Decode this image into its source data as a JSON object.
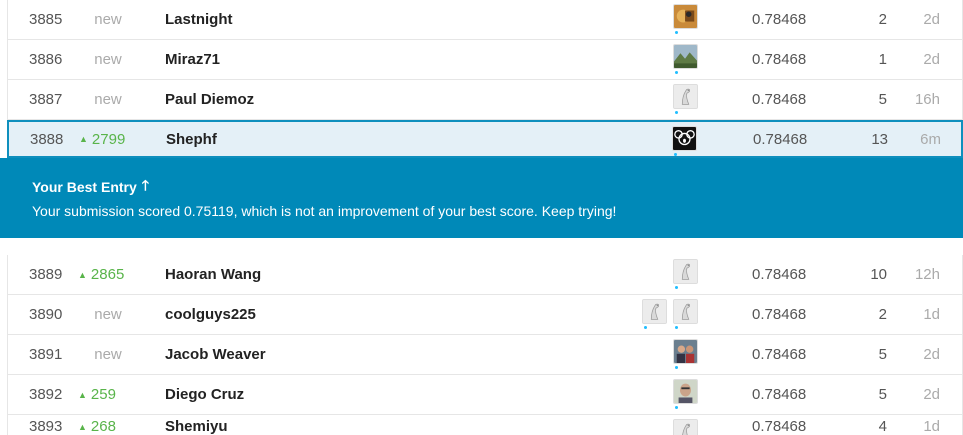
{
  "upper_rows": [
    {
      "rank": "3885",
      "change": "new",
      "change_dir": "new",
      "team": "Lastnight",
      "avatars": [
        "photo-orange"
      ],
      "score": "0.78468",
      "entries": "2",
      "last": "2d"
    },
    {
      "rank": "3886",
      "change": "new",
      "change_dir": "new",
      "team": "Miraz71",
      "avatars": [
        "photo-landscape"
      ],
      "score": "0.78468",
      "entries": "1",
      "last": "2d"
    },
    {
      "rank": "3887",
      "change": "new",
      "change_dir": "new",
      "team": "Paul Diemoz",
      "avatars": [
        "default-goose"
      ],
      "score": "0.78468",
      "entries": "5",
      "last": "16h"
    },
    {
      "rank": "3888",
      "change": "2799",
      "change_dir": "up",
      "team": "Shephf",
      "avatars": [
        "koala-black"
      ],
      "score": "0.78468",
      "entries": "13",
      "last": "6m",
      "highlight": true
    }
  ],
  "notice": {
    "title": "Your Best Entry",
    "icon": "arrow-up-icon",
    "message": "Your submission scored 0.75119, which is not an improvement of your best score. Keep trying!"
  },
  "lower_rows": [
    {
      "rank": "3889",
      "change": "2865",
      "change_dir": "up",
      "team": "Haoran Wang",
      "avatars": [
        "default-goose"
      ],
      "score": "0.78468",
      "entries": "10",
      "last": "12h"
    },
    {
      "rank": "3890",
      "change": "new",
      "change_dir": "new",
      "team": "coolguys225",
      "avatars": [
        "default-goose",
        "default-goose"
      ],
      "score": "0.78468",
      "entries": "2",
      "last": "1d"
    },
    {
      "rank": "3891",
      "change": "new",
      "change_dir": "new",
      "team": "Jacob Weaver",
      "avatars": [
        "photo-group"
      ],
      "score": "0.78468",
      "entries": "5",
      "last": "2d"
    },
    {
      "rank": "3892",
      "change": "259",
      "change_dir": "up",
      "team": "Diego Cruz",
      "avatars": [
        "photo-face"
      ],
      "score": "0.78468",
      "entries": "5",
      "last": "2d"
    },
    {
      "rank": "3893",
      "change": "268",
      "change_dir": "up",
      "team": "Shemiyu",
      "avatars": [
        "default-goose"
      ],
      "score": "0.78468",
      "entries": "4",
      "last": "1d",
      "partial": true
    }
  ],
  "colors": {
    "accent": "#0089b8",
    "highlight_border": "#0f8fbd",
    "highlight_bg": "#e4f0f7",
    "up": "#59b44a",
    "muted": "#aaaaaa"
  }
}
